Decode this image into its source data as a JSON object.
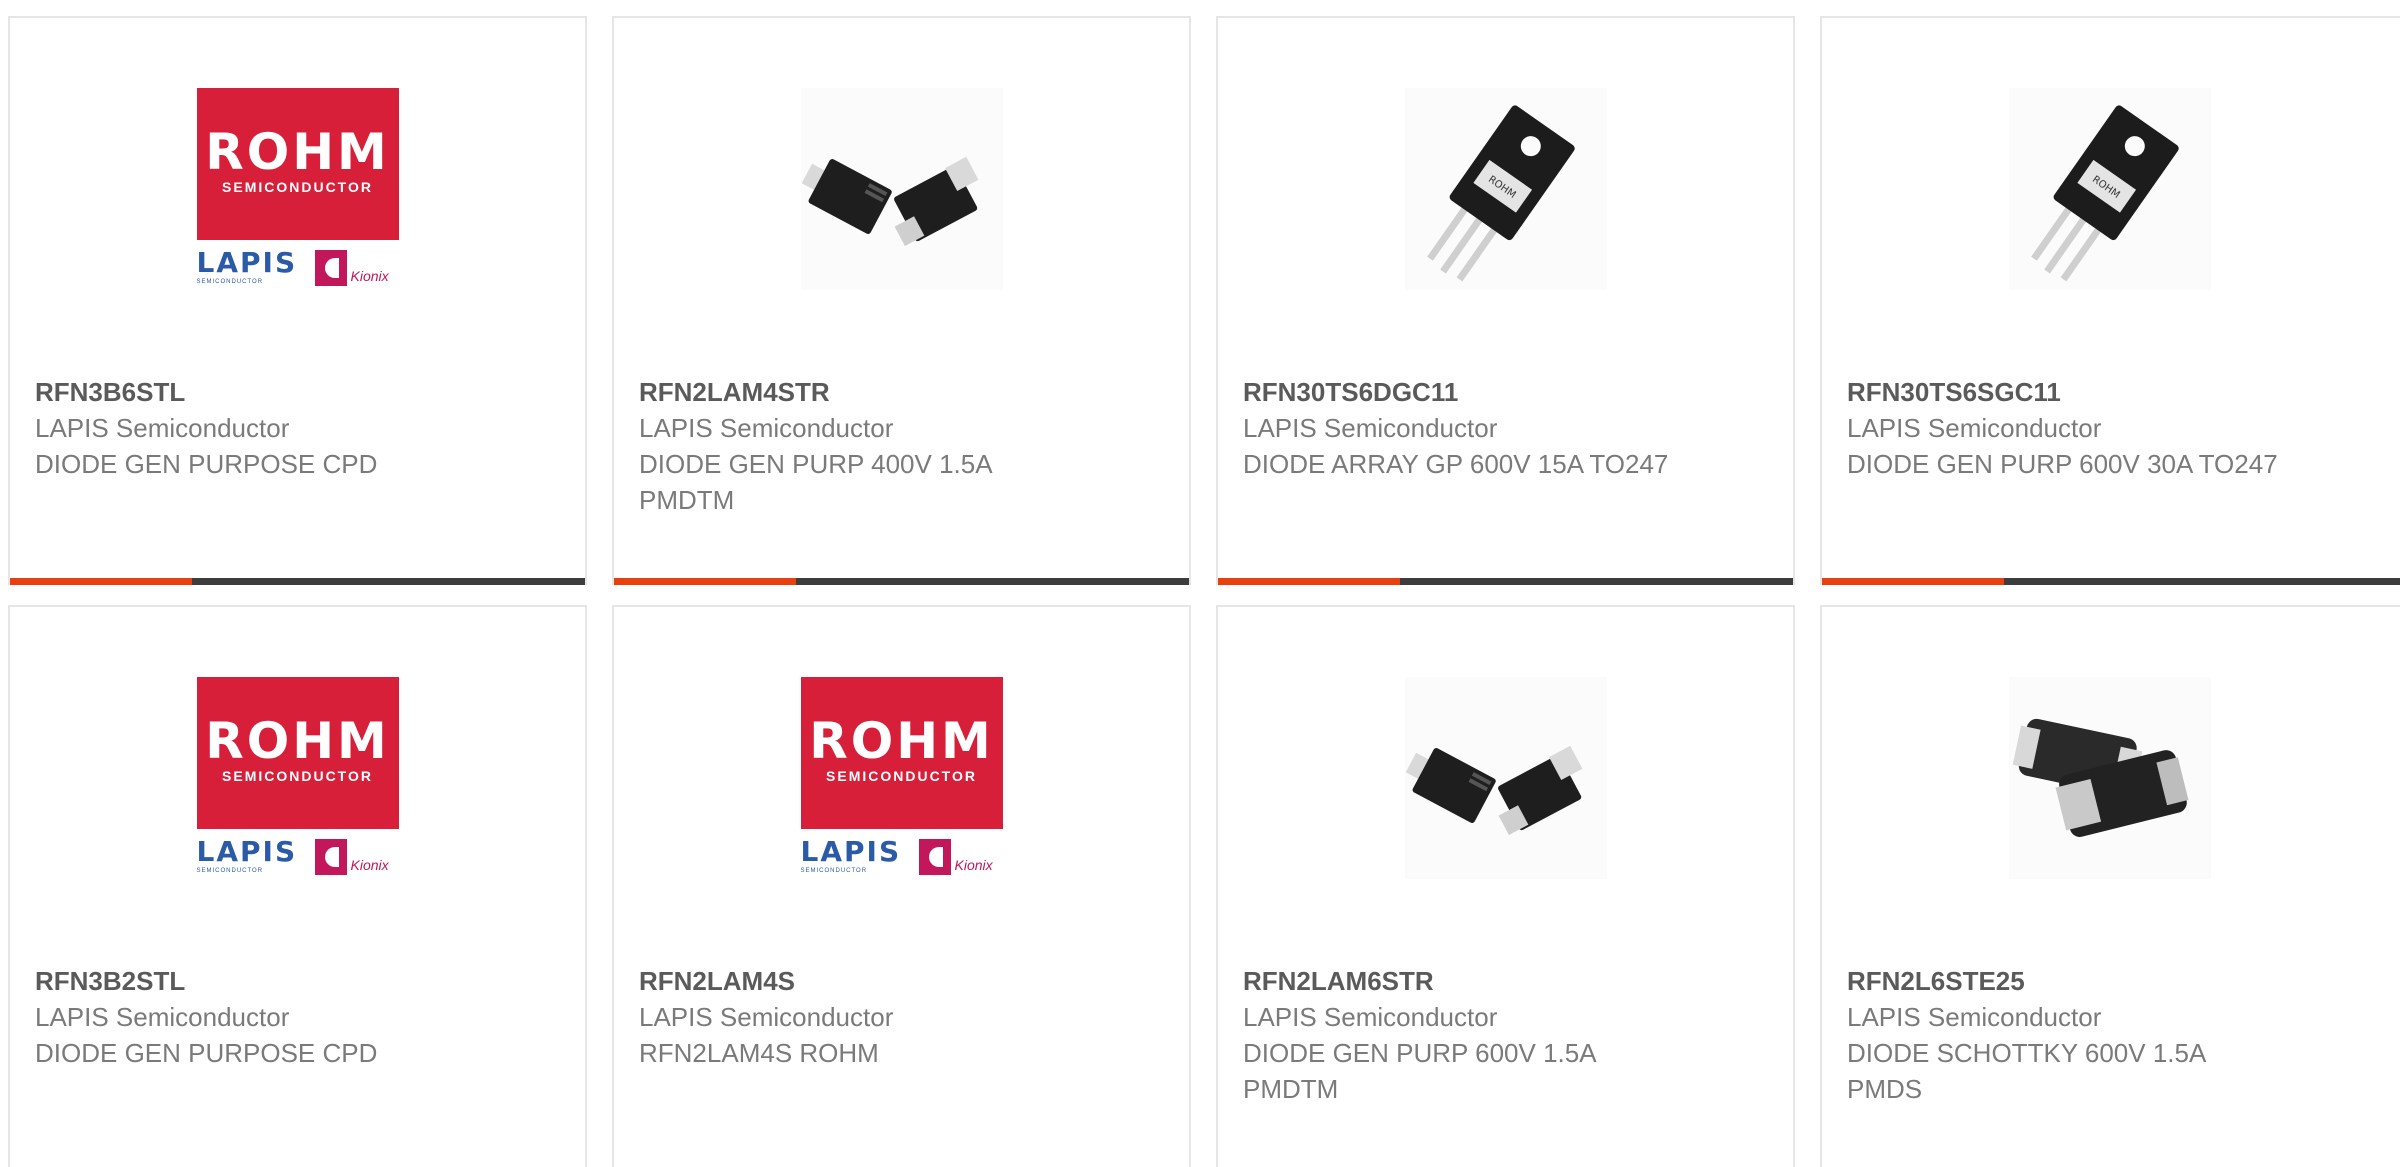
{
  "cards": [
    {
      "part": "RFN3B6STL",
      "manufacturer": "LAPIS Semiconductor",
      "description": "DIODE GEN PURPOSE CPD",
      "image": "rohm-lapis-logo",
      "logo": {
        "brand": "ROHM",
        "sub": "SEMICONDUCTOR",
        "lapis": "LAPIS",
        "lapis_sub": "SEMICONDUCTOR",
        "kionix": "Kionix"
      }
    },
    {
      "part": "RFN2LAM4STR",
      "manufacturer": "LAPIS Semiconductor",
      "description": "DIODE GEN PURP 400V 1.5A PMDTM",
      "image": "smd-diode-pair"
    },
    {
      "part": "RFN30TS6DGC11",
      "manufacturer": "LAPIS Semiconductor",
      "description": "DIODE ARRAY GP 600V 15A TO247",
      "image": "to247-package"
    },
    {
      "part": "RFN30TS6SGC11",
      "manufacturer": "LAPIS Semiconductor",
      "description": "DIODE GEN PURP 600V 30A TO247",
      "image": "to247-package"
    },
    {
      "part": "RFN3B2STL",
      "manufacturer": "LAPIS Semiconductor",
      "description": "DIODE GEN PURPOSE CPD",
      "image": "rohm-lapis-logo",
      "logo": {
        "brand": "ROHM",
        "sub": "SEMICONDUCTOR",
        "lapis": "LAPIS",
        "lapis_sub": "SEMICONDUCTOR",
        "kionix": "Kionix"
      }
    },
    {
      "part": "RFN2LAM4S",
      "manufacturer": "LAPIS Semiconductor",
      "description": "RFN2LAM4S ROHM",
      "image": "rohm-lapis-logo",
      "logo": {
        "brand": "ROHM",
        "sub": "SEMICONDUCTOR",
        "lapis": "LAPIS",
        "lapis_sub": "SEMICONDUCTOR",
        "kionix": "Kionix"
      }
    },
    {
      "part": "RFN2LAM6STR",
      "manufacturer": "LAPIS Semiconductor",
      "description": "DIODE GEN PURP 600V 1.5A PMDTM",
      "image": "smd-diode-pair"
    },
    {
      "part": "RFN2L6STE25",
      "manufacturer": "LAPIS Semiconductor",
      "description": "DIODE SCHOTTKY 600V 1.5A PMDS",
      "image": "pmds-diode-pair"
    }
  ],
  "colors": {
    "accent": "#e8400f",
    "bar": "#3d3d3d",
    "rohm_red": "#d71f3a",
    "lapis_blue": "#2a5aa8"
  }
}
